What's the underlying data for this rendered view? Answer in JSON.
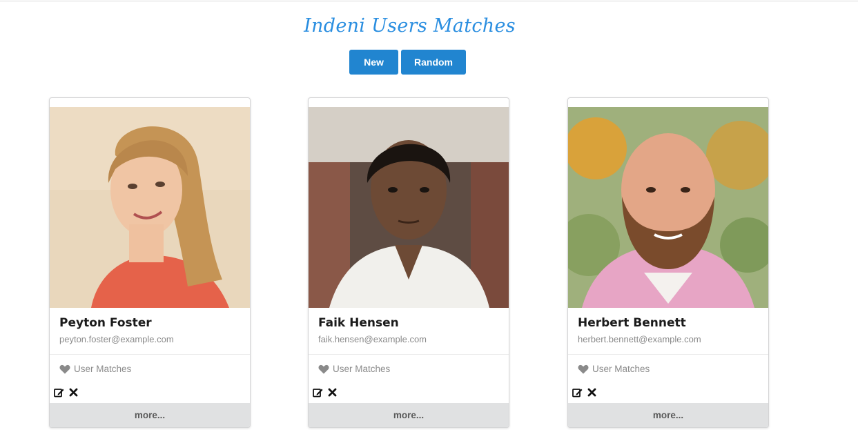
{
  "header": {
    "title": "Indeni Users Matches",
    "new_label": "New",
    "random_label": "Random"
  },
  "colors": {
    "accent": "#2185d0",
    "title": "#2a8ee0",
    "more_bg": "#e0e1e2"
  },
  "users": [
    {
      "name": "Peyton Foster",
      "email": "peyton.foster@example.com",
      "matches_label": "User Matches",
      "more_label": "more...",
      "photo_icon": "woman-portrait"
    },
    {
      "name": "Faik Hensen",
      "email": "faik.hensen@example.com",
      "matches_label": "User Matches",
      "more_label": "more...",
      "photo_icon": "man-portrait"
    },
    {
      "name": "Herbert Bennett",
      "email": "herbert.bennett@example.com",
      "matches_label": "User Matches",
      "more_label": "more...",
      "photo_icon": "bearded-man-portrait"
    }
  ]
}
